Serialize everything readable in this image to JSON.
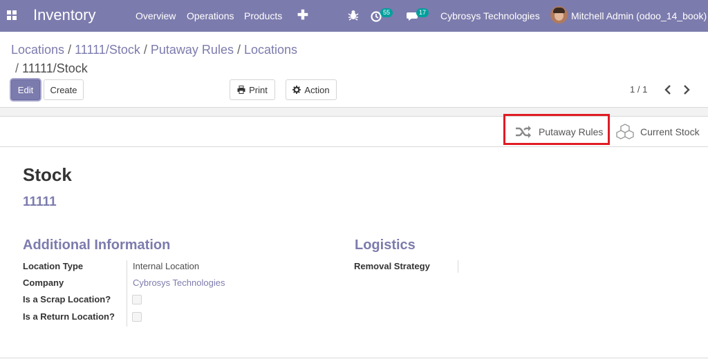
{
  "navbar": {
    "app_title": "Inventory",
    "menu": [
      "Overview",
      "Operations",
      "Products"
    ],
    "plus": "✚",
    "activity_count": "55",
    "message_count": "17",
    "company": "Cybrosys Technologies",
    "user": "Mitchell Admin (odoo_14_book)"
  },
  "breadcrumb": {
    "items": [
      "Locations",
      "11111/Stock",
      "Putaway Rules",
      "Locations"
    ],
    "separator": "/",
    "current": "11111/Stock"
  },
  "toolbar": {
    "edit_label": "Edit",
    "create_label": "Create",
    "print_label": "Print",
    "action_label": "Action"
  },
  "pager": {
    "value": "1 / 1"
  },
  "button_box": {
    "putaway_label": "Putaway Rules",
    "current_stock_label": "Current Stock"
  },
  "record": {
    "name": "Stock",
    "parent": "11111"
  },
  "additional_info": {
    "title": "Additional Information",
    "fields": [
      {
        "label": "Location Type",
        "value": "Internal Location"
      },
      {
        "label": "Company",
        "value": "Cybrosys Technologies"
      },
      {
        "label": "Is a Scrap Location?",
        "checked": false
      },
      {
        "label": "Is a Return Location?",
        "checked": false
      }
    ]
  },
  "logistics": {
    "title": "Logistics",
    "fields": [
      {
        "label": "Removal Strategy",
        "value": ""
      }
    ]
  },
  "colors": {
    "brand": "#7c7bad",
    "highlight": "#e01b24",
    "badge": "#00a09d"
  }
}
